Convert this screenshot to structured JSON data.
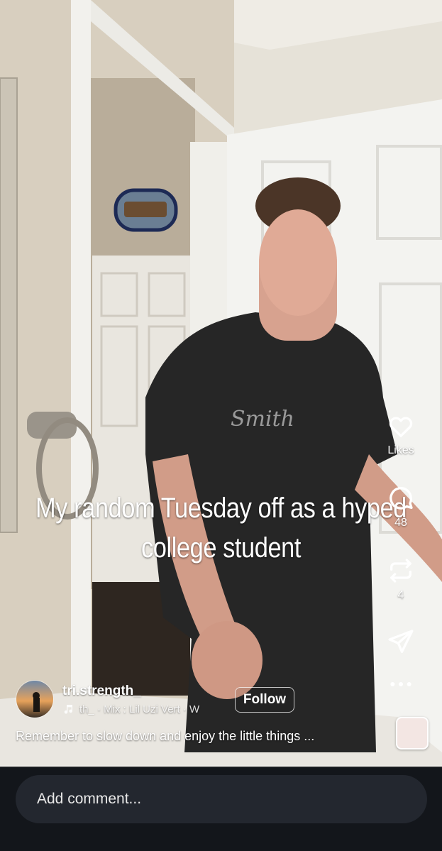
{
  "video": {
    "caption_lines": [
      "My random Tuesday off as a hyped",
      "college student"
    ],
    "progress": 0.0
  },
  "actions": {
    "likes_label": "Likes",
    "comments_count": "48",
    "reposts_count": "4"
  },
  "author": {
    "handle": "tri.strength_",
    "audio_text": "th_ · Mix : Lil Uzi Vert · W",
    "follow_label": "Follow"
  },
  "description": "Remember to slow down and enjoy the little things ...",
  "comment": {
    "placeholder": "Add comment..."
  },
  "icons": {
    "like": "heart-icon",
    "comment": "comment-bubble-icon",
    "repost": "repost-icon",
    "share": "send-icon",
    "more": "more-dots-icon",
    "audio": "music-note-icon"
  }
}
